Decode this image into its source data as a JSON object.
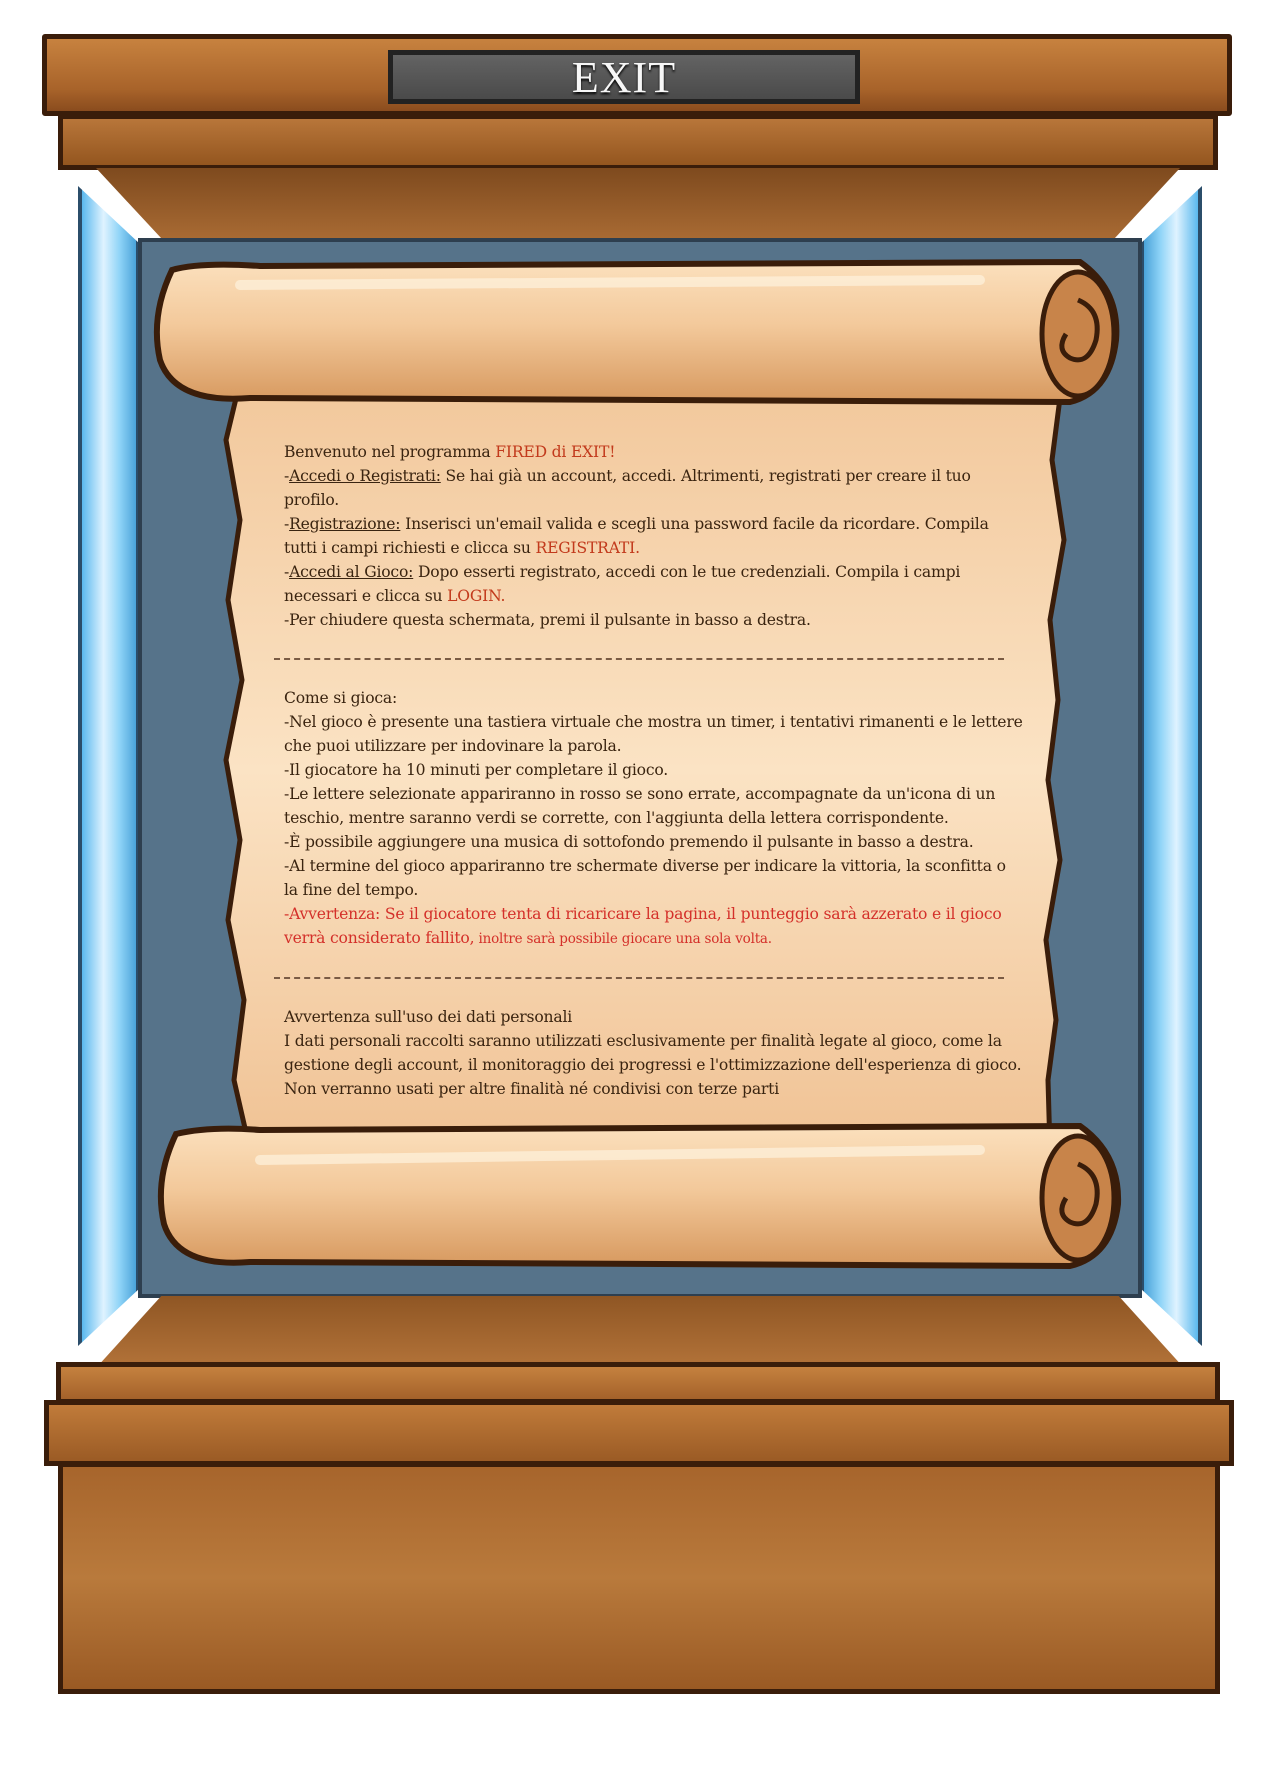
{
  "header": {
    "exit_label": "EXIT"
  },
  "intro": {
    "welcome_prefix": "Benvenuto nel programma ",
    "welcome_highlight": "FIRED di EXIT!",
    "login_prefix": "-",
    "login_title": "Accedi o Registrati:",
    "login_text": " Se hai già un account, accedi. Altrimenti, registrati per creare il tuo profilo.",
    "register_prefix": "-",
    "register_title": "Registrazione:",
    "register_text": " Inserisci un'email valida e scegli una password facile da ricordare. Compila tutti i campi richiesti e clicca su ",
    "register_highlight": "REGISTRATI.",
    "game_login_prefix": "-",
    "game_login_title": "Accedi al Gioco:",
    "game_login_text": " Dopo esserti registrato, accedi con le tue credenziali. Compila i campi necessari e clicca su ",
    "game_login_highlight": "LOGIN.",
    "close_text": "-Per chiudere questa schermata, premi il pulsante in basso a destra."
  },
  "how_to_play": {
    "title": "Come si gioca:",
    "items": [
      "-Nel gioco è presente una tastiera virtuale che mostra un timer, i tentativi rimanenti e le lettere che puoi utilizzare per indovinare la parola.",
      "-Il giocatore ha 10 minuti per completare il gioco.",
      "-Le lettere selezionate appariranno in rosso se sono errate, accompagnate da un'icona di un teschio, mentre saranno verdi se corrette, con l'aggiunta della lettera corrispondente.",
      "-È possibile aggiungere una musica di sottofondo premendo il pulsante in basso a destra.",
      "-Al termine del gioco appariranno tre schermate diverse per indicare la vittoria, la sconfitta o la fine del tempo."
    ],
    "warning_main": "-Avvertenza: Se il giocatore tenta di ricaricare la pagina, il punteggio sarà azzerato e il gioco verrà considerato fallito,",
    "warning_small": " inoltre sarà possibile giocare una sola volta."
  },
  "privacy": {
    "title": "Avvertenza sull'uso dei dati personali",
    "text": "I dati personali raccolti saranno utilizzati esclusivamente per finalità legate al gioco, come la gestione degli account, il monitoraggio dei progressi e l'ottimizzazione dell'esperienza di gioco. Non verranno usati per altre finalità né condivisi con terze parti"
  },
  "colors": {
    "wood": "#a8632a",
    "glass": "#8ed3f7",
    "backwall": "#56738a",
    "parchment": "#f4cfa4",
    "highlight_red": "#c23a1c",
    "warning_red": "#d4302a"
  }
}
